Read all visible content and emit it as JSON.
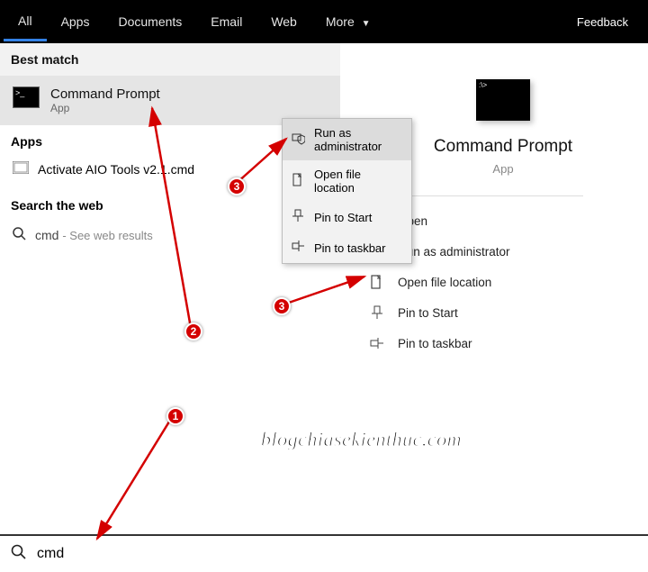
{
  "topbar": {
    "tabs": [
      "All",
      "Apps",
      "Documents",
      "Email",
      "Web",
      "More"
    ],
    "more_chevron": "▼",
    "feedback": "Feedback"
  },
  "left": {
    "best_match_header": "Best match",
    "best_match_title": "Command Prompt",
    "best_match_sub": "App",
    "apps_header": "Apps",
    "apps_item": "Activate AIO Tools v2.1.cmd",
    "search_header": "Search the web",
    "web_item_prefix": "cmd",
    "web_item_suffix": "- See web results",
    "chevron": "›"
  },
  "context_menu": {
    "items": [
      "Run as administrator",
      "Open file location",
      "Pin to Start",
      "Pin to taskbar"
    ]
  },
  "right": {
    "title": "Command Prompt",
    "sub": "App",
    "actions": [
      "Open",
      "Run as administrator",
      "Open file location",
      "Pin to Start",
      "Pin to taskbar"
    ]
  },
  "search": {
    "value": "cmd"
  },
  "annotations": {
    "badge1": "1",
    "badge2": "2",
    "badge3a": "3",
    "badge3b": "3",
    "watermark": "blogchiasekienthuc.com"
  }
}
